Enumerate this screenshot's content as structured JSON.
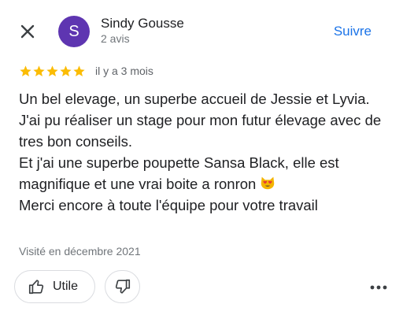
{
  "header": {
    "author_initial": "S",
    "author_name": "Sindy Gousse",
    "author_reviews": "2 avis",
    "follow_label": "Suivre"
  },
  "rating": {
    "stars": 5,
    "max": 5,
    "date": "il y a 3 mois",
    "star_color": "#fbbc04"
  },
  "review": {
    "lines": [
      "Un bel elevage, un superbe accueil de Jessie et Lyvia.",
      "J'ai pu réaliser un stage pour mon futur élevage avec de tres bon conseils.",
      "Et j'ai une superbe poupette Sansa Black, elle est magnifique et une vrai boite a ronron",
      "Merci encore à toute l'équipe pour votre travail"
    ]
  },
  "visit": "Visité en décembre 2021",
  "actions": {
    "helpful_label": "Utile"
  },
  "colors": {
    "accent": "#1a73e8",
    "avatar": "#5e35b1"
  },
  "icons": [
    "close-icon",
    "star-icon",
    "heart-eyes-cat-emoji",
    "thumbs-up-icon",
    "thumbs-down-icon",
    "more-horizontal-icon"
  ]
}
